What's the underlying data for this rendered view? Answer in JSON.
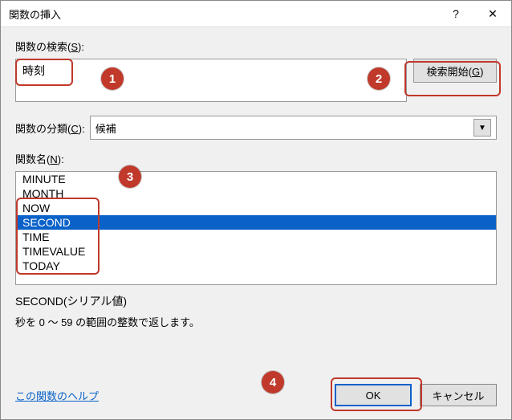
{
  "title": "関数の挿入",
  "labels": {
    "search_pre": "関数の検索(",
    "search_u": "S",
    "search_post": "):",
    "category_pre": "関数の分類(",
    "category_u": "C",
    "category_post": "):",
    "fn_pre": "関数名(",
    "fn_u": "N",
    "fn_post": "):"
  },
  "search": {
    "value": "時刻"
  },
  "buttons": {
    "go_pre": "検索開始(",
    "go_u": "G",
    "go_post": ")",
    "ok": "OK",
    "cancel": "キャンセル"
  },
  "category": {
    "value": "候補"
  },
  "functions": [
    {
      "name": "MINUTE",
      "selected": false
    },
    {
      "name": "MONTH",
      "selected": false
    },
    {
      "name": "NOW",
      "selected": false
    },
    {
      "name": "SECOND",
      "selected": true
    },
    {
      "name": "TIME",
      "selected": false
    },
    {
      "name": "TIMEVALUE",
      "selected": false
    },
    {
      "name": "TODAY",
      "selected": false
    }
  ],
  "detail": {
    "signature": "SECOND(シリアル値)",
    "description": "秒を 0 ～ 59 の範囲の整数で返します。"
  },
  "footer": {
    "help": "この関数のヘルプ"
  },
  "markers": [
    "1",
    "2",
    "3",
    "4"
  ]
}
